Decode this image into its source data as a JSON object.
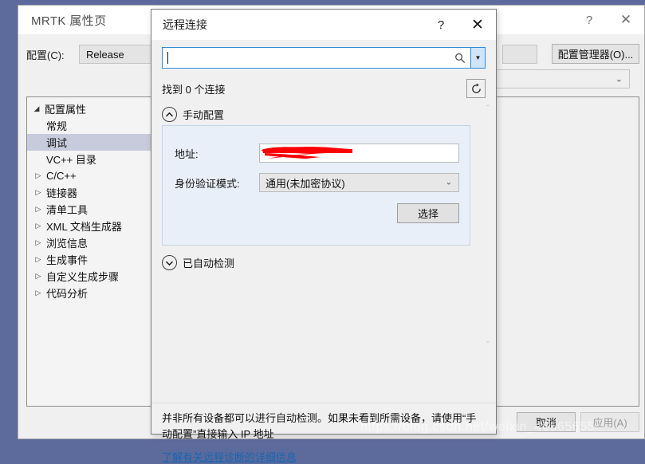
{
  "background_window": {
    "title": "MRTK 属性页",
    "help_icon": "?",
    "close_icon": "✕",
    "config_label": "配置(C):",
    "config_value": "Release",
    "config_manager_button": "配置管理器(O)...",
    "tree": [
      {
        "label": "配置属性",
        "level": 1,
        "twisty": "expanded",
        "selected": false
      },
      {
        "label": "常规",
        "level": 2,
        "twisty": "none",
        "selected": false
      },
      {
        "label": "调试",
        "level": 2,
        "twisty": "none",
        "selected": true
      },
      {
        "label": "VC++ 目录",
        "level": 2,
        "twisty": "none",
        "selected": false
      },
      {
        "label": "C/C++",
        "level": 2,
        "twisty": "collapsed",
        "selected": false
      },
      {
        "label": "链接器",
        "level": 2,
        "twisty": "collapsed",
        "selected": false
      },
      {
        "label": "清单工具",
        "level": 2,
        "twisty": "collapsed",
        "selected": false
      },
      {
        "label": "XML 文档生成器",
        "level": 2,
        "twisty": "collapsed",
        "selected": false
      },
      {
        "label": "浏览信息",
        "level": 2,
        "twisty": "collapsed",
        "selected": false
      },
      {
        "label": "生成事件",
        "level": 2,
        "twisty": "collapsed",
        "selected": false
      },
      {
        "label": "自定义生成步骤",
        "level": 2,
        "twisty": "collapsed",
        "selected": false
      },
      {
        "label": "代码分析",
        "level": 2,
        "twisty": "collapsed",
        "selected": false
      }
    ],
    "cancel_button": "取消",
    "apply_button": "应用(A)"
  },
  "dialog": {
    "title": "远程连接",
    "help_icon": "?",
    "close_icon": "✕",
    "search": {
      "value": "",
      "placeholder": "",
      "search_icon": "search-icon",
      "dropdown_icon": "▼"
    },
    "found_text": "找到 0 个连接",
    "refresh_icon": "refresh-icon",
    "manual_section": {
      "label": "手动配置",
      "state": "expanded",
      "address_label": "地址:",
      "address_value": "",
      "auth_label": "身份验证模式:",
      "auth_value": "通用(未加密协议)",
      "select_button": "选择"
    },
    "auto_section": {
      "label": "已自动检测",
      "state": "collapsed"
    },
    "footer_note": "并非所有设备都可以进行自动检测。如果未看到所需设备，请使用“手动配置”直接输入 IP 地址",
    "footer_link": "了解有关远程诊断的详细信息"
  },
  "watermark": "https://blog.csdn.net/weixin_46565655",
  "colors": {
    "desktop": "#5d6a9c",
    "accent_blue": "#2e8ad8",
    "panel_blue": "#e9eff8",
    "link": "#1966b2",
    "redaction_red": "#fe0000"
  }
}
